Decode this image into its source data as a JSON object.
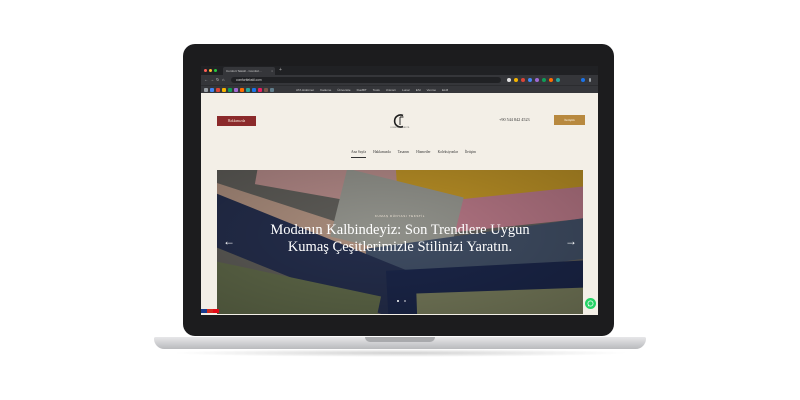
{
  "browser": {
    "tab_title": "Comfort Tekstil - Comfort...",
    "tab_close": "×",
    "new_tab": "+",
    "url": "comforttekstil.com",
    "nav": {
      "back": "←",
      "forward": "→",
      "reload": "↻",
      "home": "⌂"
    },
    "bookmarks": [
      "ATA Hükümet",
      "Kademe",
      "Üniversite",
      "DuoBIT",
      "Tools",
      "Unicorn",
      "Lunar",
      "ESI",
      "Venmo",
      "ELM"
    ]
  },
  "site": {
    "cta_left": "Hakkımızda",
    "logo_subtitle": "COMFORT TEKSTİL",
    "phone": "+90 544 842 4523",
    "cta_right": "İletişim",
    "menu": [
      "Ana Sayfa",
      "Hakkımızda",
      "Tasarım",
      "Hizmetler",
      "Koleksiyonlar",
      "İletişim"
    ],
    "hero": {
      "kicker": "KUMAŞ DÜNYASI TEKSTİL",
      "title_line1": "Modanın Kalbindeyiz: Son Trendlere Uygun",
      "title_line2": "Kumaş Çeşitlerimizle Stilinizi Yaratın.",
      "prev": "←",
      "next": "→",
      "slides_total": 2,
      "active_slide": 1
    }
  },
  "colors": {
    "chrome_dark": "#202124",
    "chrome_mid": "#35363a",
    "brand_red": "#8b2a2b",
    "brand_gold": "#b8893f",
    "page_bg": "#f3efe7",
    "whatsapp": "#25d366"
  },
  "icons": {
    "whatsapp": "whatsapp-icon",
    "logo": "comfort-logo",
    "prev": "arrow-left-icon",
    "next": "arrow-right-icon"
  }
}
